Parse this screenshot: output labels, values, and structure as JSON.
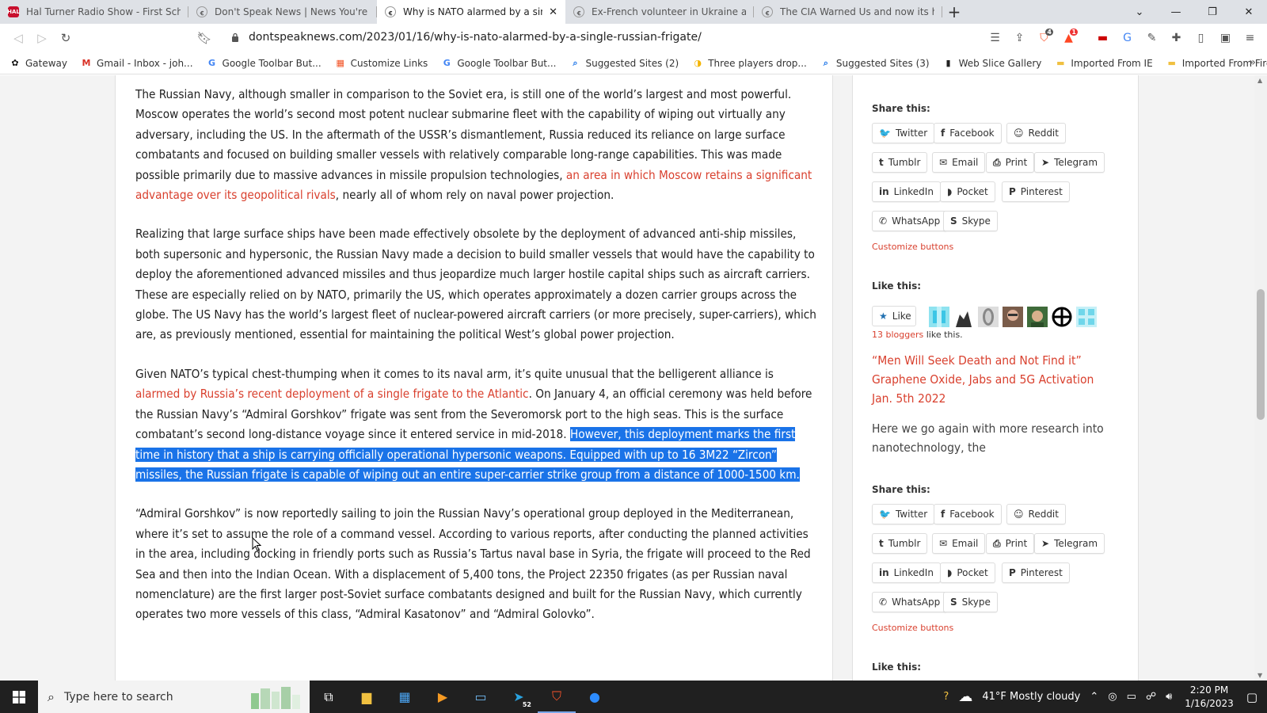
{
  "tabs": [
    {
      "title": "Hal Turner Radio Show - First Schwab",
      "icon": "hal-turner-favicon",
      "icon_text": "HAL",
      "active": false
    },
    {
      "title": "Don't Speak News | News You're Not",
      "icon": "dontspeak-favicon",
      "active": false
    },
    {
      "title": "Why is NATO alarmed by a single",
      "icon": "dontspeak-favicon",
      "active": true
    },
    {
      "title": "Ex-French volunteer in Ukraine asks fo",
      "icon": "dontspeak-favicon",
      "active": false
    },
    {
      "title": "The CIA Warned Us and now its here",
      "icon": "dontspeak-favicon",
      "active": false
    }
  ],
  "address_bar": {
    "url": "dontspeaknews.com/2023/01/16/why-is-nato-alarmed-by-a-single-russian-frigate/"
  },
  "extensions": {
    "brave_shields_count": "4",
    "brave_rewards_count": "1"
  },
  "bookmarks": [
    {
      "label": "Gateway",
      "icon": "gateway-icon",
      "color": "#111"
    },
    {
      "label": "Gmail - Inbox - joh...",
      "icon": "gmail-icon",
      "color": "#d93025"
    },
    {
      "label": "Google Toolbar But...",
      "icon": "google-icon",
      "color": "#4285f4"
    },
    {
      "label": "Customize Links",
      "icon": "windows-icon",
      "color": "#f25022"
    },
    {
      "label": "Google Toolbar But...",
      "icon": "google-icon",
      "color": "#4285f4"
    },
    {
      "label": "Suggested Sites (2)",
      "icon": "search-icon",
      "color": "#1a73e8"
    },
    {
      "label": "Three players drop...",
      "icon": "news-icon",
      "color": "#f4b400"
    },
    {
      "label": "Suggested Sites (3)",
      "icon": "search-icon",
      "color": "#1a73e8"
    },
    {
      "label": "Web Slice Gallery",
      "icon": "web-slice-icon",
      "color": "#222"
    },
    {
      "label": "Imported From IE",
      "icon": "folder-icon",
      "color": "#f0c040"
    },
    {
      "label": "Imported From Fire...",
      "icon": "folder-icon",
      "color": "#f0c040"
    }
  ],
  "article": {
    "p1_a": "The Russian Navy, although smaller in comparison to the Soviet era, is still one of the world’s largest and most powerful. Moscow operates the world’s second most potent nuclear submarine fleet with the capability of wiping out virtually any adversary, including the US. In the aftermath of the USSR’s dismantlement, Russia reduced its reliance on large surface combatants and focused on building smaller vessels with relatively comparable long-range capabilities. This was made possible primarily due to massive advances in missile propulsion technologies, ",
    "p1_link": "an area in which Moscow retains a significant advantage over its geopolitical rivals",
    "p1_b": ", nearly all of whom rely on naval power projection.",
    "p2": "Realizing that large surface ships have been made effectively obsolete by the deployment of advanced anti-ship missiles, both supersonic and hypersonic, the Russian Navy made a decision to build smaller vessels that would have the capability to deploy the aforementioned advanced missiles and thus jeopardize much larger hostile capital ships such as aircraft carriers. These are especially relied on by NATO, primarily the US, which operates approximately a dozen carrier groups across the globe. The US Navy has the world’s largest fleet of nuclear-powered aircraft carriers (or more precisely, super-carriers), which are, as previously mentioned, essential for maintaining the political West’s global power projection.",
    "p3_a": "Given NATO’s typical chest-thumping when it comes to its naval arm, it’s quite unusual that the belligerent alliance is ",
    "p3_link": "alarmed by Russia’s recent deployment of a single frigate to the Atlantic",
    "p3_b": ". On January 4, an official ceremony was held before the Russian Navy’s “Admiral Gorshkov” frigate was sent from the Severomorsk port to the high seas. This is the surface combatant’s second long-distance voyage since it entered service in mid-2018. ",
    "p3_selected": "However, this deployment marks the first time in history that a ship is carrying officially operational hypersonic weapons. Equipped with up to 16 3M22 “Zircon” missiles, the Russian frigate is capable of wiping out an entire super-carrier strike group from a distance of 1000-1500 km.",
    "p4": "“Admiral Gorshkov” is now reportedly sailing to join the Russian Navy’s operational group deployed in the Mediterranean, where it’s set to assume the role of a command vessel. According to various reports, after conducting the planned activities in the area, including docking in friendly ports such as Russia’s Tartus naval base in Syria, the frigate will proceed to the Red Sea and then into the Indian Ocean. With a displacement of 5,400 tons, the Project 22350 frigates (as per Russian naval nomenclature) are the first larger post-Soviet surface combatants designed and built for the Russian Navy, which currently operates two more vessels of this class, “Admiral Kasatonov” and “Admiral Golovko”."
  },
  "sidebar": {
    "share_heading": "Share this:",
    "share_buttons": [
      {
        "label": "Twitter",
        "icon": "twitter-icon",
        "glyph": "🐦"
      },
      {
        "label": "Facebook",
        "icon": "facebook-icon",
        "glyph": "f"
      },
      {
        "label": "Reddit",
        "icon": "reddit-icon",
        "glyph": "☺"
      },
      {
        "label": "Tumblr",
        "icon": "tumblr-icon",
        "glyph": "t"
      },
      {
        "label": "Email",
        "icon": "email-icon",
        "glyph": "✉"
      },
      {
        "label": "Print",
        "icon": "print-icon",
        "glyph": "⎙"
      },
      {
        "label": "Telegram",
        "icon": "telegram-icon",
        "glyph": "➤"
      },
      {
        "label": "LinkedIn",
        "icon": "linkedin-icon",
        "glyph": "in"
      },
      {
        "label": "Pocket",
        "icon": "pocket-icon",
        "glyph": "◗"
      },
      {
        "label": "Pinterest",
        "icon": "pinterest-icon",
        "glyph": "P"
      },
      {
        "label": "WhatsApp",
        "icon": "whatsapp-icon",
        "glyph": "✆"
      },
      {
        "label": "Skype",
        "icon": "skype-icon",
        "glyph": "S"
      }
    ],
    "customize": "Customize buttons",
    "like_heading": "Like this:",
    "like_button": "Like",
    "bloggers_count": "13 bloggers",
    "bloggers_suffix": " like this.",
    "related_title": "“Men Will Seek Death and Not Find it” Graphene Oxide, Jabs and 5G Activation Jan. 5th 2022",
    "related_excerpt": "Here we go again with more research into nanotechnology, the",
    "like_heading_2": "Like this:"
  },
  "taskbar": {
    "search_placeholder": "Type here to search",
    "telegram_badge": "52",
    "weather": "41°F  Mostly cloudy",
    "time": "2:20 PM",
    "date": "1/16/2023"
  },
  "colors": {
    "link": "#d9412f",
    "selection": "#1a73e8",
    "taskbar": "#202020"
  }
}
